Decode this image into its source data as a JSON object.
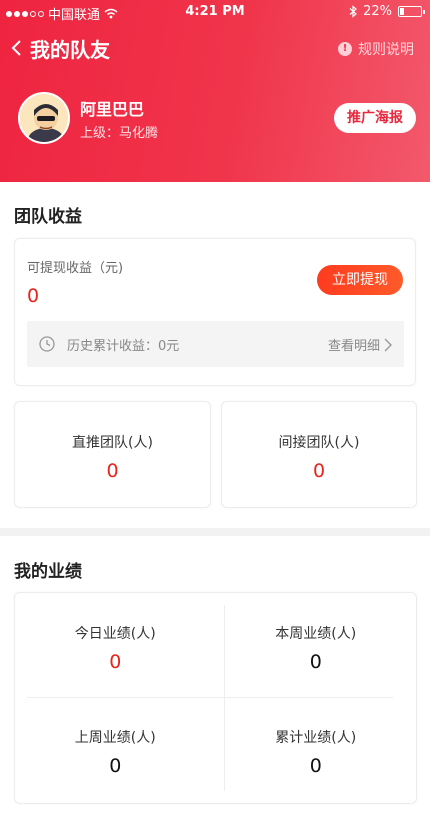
{
  "status_bar": {
    "carrier": "中国联通",
    "time": "4:21 PM",
    "battery": "22%",
    "battery_level": 0.22
  },
  "nav": {
    "title": "我的队友",
    "rules_label": "规则说明"
  },
  "user": {
    "name": "阿里巴巴",
    "superior": "上级：马化腾",
    "poster_button": "推广海报"
  },
  "team_earnings": {
    "section_title": "团队收益",
    "withdrawable_label": "可提现收益（元)",
    "withdrawable_amount": "0",
    "withdraw_button": "立即提现",
    "history_text": "历史累计收益：0元",
    "history_link": "查看明细"
  },
  "teams": [
    {
      "label": "直推团队(人)",
      "value": "0"
    },
    {
      "label": "间接团队(人)",
      "value": "0"
    }
  ],
  "performance": {
    "section_title": "我的业绩",
    "items": [
      {
        "label": "今日业绩(人)",
        "value": "0"
      },
      {
        "label": "本周业绩(人)",
        "value": "0"
      },
      {
        "label": "上周业绩(人)",
        "value": "0"
      },
      {
        "label": "累计业绩(人)",
        "value": "0"
      }
    ]
  },
  "colors": {
    "brand_red": "#ef2440",
    "accent_orange": "#ff3b1f",
    "value_red": "#e8251d"
  },
  "icons": [
    "back-chevron-icon",
    "info-icon",
    "clock-icon",
    "chevron-right-icon",
    "wifi-icon",
    "bluetooth-icon",
    "battery-icon",
    "signal-dots-icon"
  ]
}
